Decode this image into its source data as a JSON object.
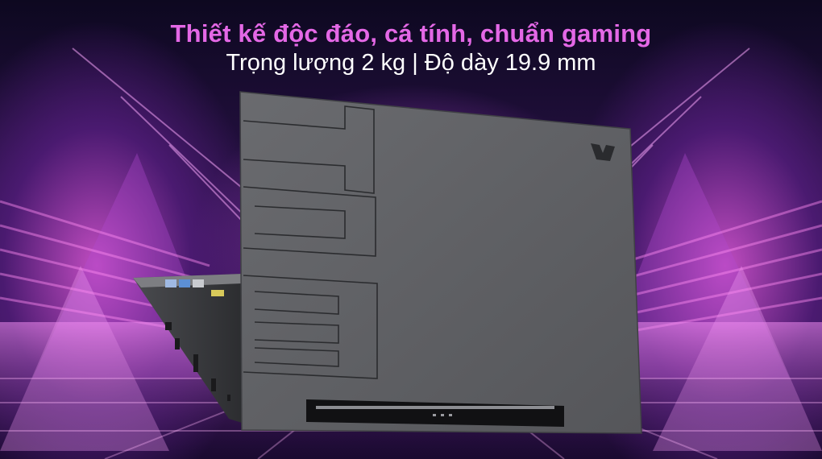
{
  "banner": {
    "headline": "Thiết kế độc đáo, cá tính, chuẩn gaming",
    "subline": "Trọng lượng 2 kg | Độ dày 19.9 mm"
  },
  "colors": {
    "headline": "#e468e6",
    "subline": "#ffffff",
    "lid": "#5d5e62",
    "neon": "#d46ae0"
  }
}
